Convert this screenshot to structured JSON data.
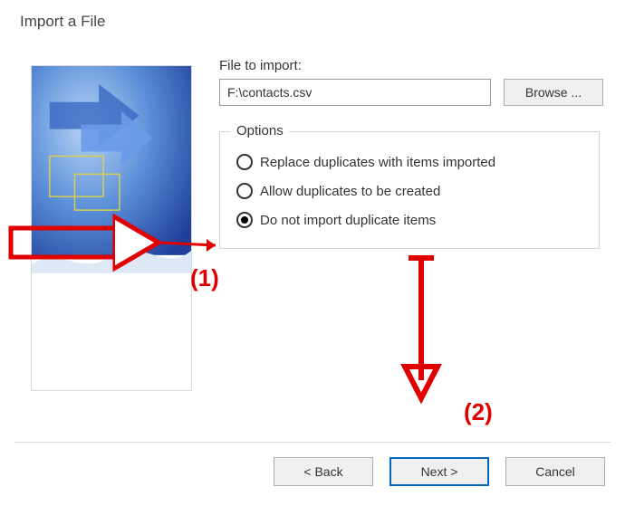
{
  "dialog": {
    "title": "Import a File",
    "file_label": "File to import:",
    "file_value": "F:\\contacts.csv",
    "browse_label": "Browse ..."
  },
  "options": {
    "legend": "Options",
    "items": [
      {
        "label": "Replace duplicates with items imported",
        "selected": false
      },
      {
        "label": "Allow duplicates to be created",
        "selected": false
      },
      {
        "label": "Do not import duplicate items",
        "selected": true
      }
    ]
  },
  "buttons": {
    "back": "< Back",
    "next": "Next >",
    "cancel": "Cancel"
  },
  "annotations": {
    "label1": "(1)",
    "label2": "(2)"
  }
}
